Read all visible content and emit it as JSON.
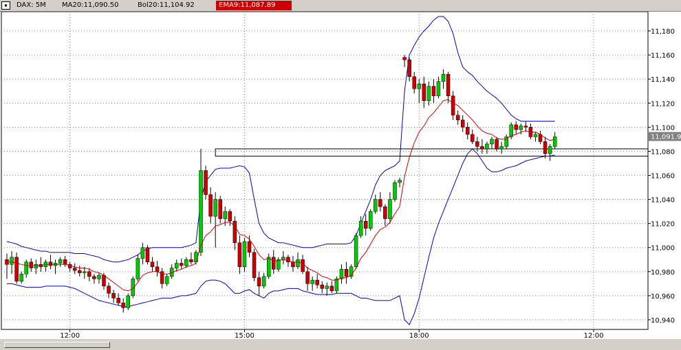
{
  "header": {
    "symbol_label": "DAX: 5M",
    "ma_label": "MA20:11,090.50",
    "bol_label": "Bol20:11,104.92",
    "ema_label": "EMA9:11,087.89",
    "ema_color": "#cc0000",
    "window_icon": "window-menu-icon"
  },
  "last_price_label": "11,091.9",
  "chart_data": {
    "type": "candlestick",
    "title": "",
    "ylim": [
      10932,
      11196
    ],
    "y_ticks": [
      {
        "value": 10940,
        "label": "10,940"
      },
      {
        "value": 10960,
        "label": "10,960"
      },
      {
        "value": 10980,
        "label": "10,980"
      },
      {
        "value": 11000,
        "label": "11,000"
      },
      {
        "value": 11020,
        "label": "11,020"
      },
      {
        "value": 11040,
        "label": "11,040"
      },
      {
        "value": 11060,
        "label": "11,060"
      },
      {
        "value": 11080,
        "label": "11,080"
      },
      {
        "value": 11100,
        "label": "11,100"
      },
      {
        "value": 11120,
        "label": "11,120"
      },
      {
        "value": 11140,
        "label": "11,140"
      },
      {
        "value": 11160,
        "label": "11,160"
      },
      {
        "value": 11180,
        "label": "11,180"
      }
    ],
    "x_ticks": [
      {
        "bar": 13,
        "label": "12:00"
      },
      {
        "bar": 49,
        "label": "15:00"
      },
      {
        "bar": 85,
        "label": "18:00"
      },
      {
        "bar": 121,
        "label": "12:00"
      }
    ],
    "vertical_grid_bars": [
      13,
      49,
      85,
      121
    ],
    "candles": [
      [
        10990,
        10995,
        10974,
        10986
      ],
      [
        10986,
        10997,
        10978,
        10992
      ],
      [
        10992,
        10996,
        10970,
        10972
      ],
      [
        10972,
        10980,
        10970,
        10978
      ],
      [
        10978,
        10990,
        10975,
        10988
      ],
      [
        10988,
        10991,
        10980,
        10983
      ],
      [
        10983,
        10990,
        10978,
        10986
      ],
      [
        10986,
        10992,
        10980,
        10984
      ],
      [
        10984,
        10990,
        10980,
        10988
      ],
      [
        10988,
        10994,
        10982,
        10985
      ],
      [
        10985,
        10990,
        10978,
        10987
      ],
      [
        10987,
        10992,
        10984,
        10990
      ],
      [
        10990,
        10993,
        10984,
        10986
      ],
      [
        10986,
        10988,
        10980,
        10983
      ],
      [
        10983,
        10987,
        10978,
        10981
      ],
      [
        10981,
        10985,
        10976,
        10979
      ],
      [
        10979,
        10984,
        10974,
        10980
      ],
      [
        10980,
        10983,
        10972,
        10976
      ],
      [
        10976,
        10978,
        10970,
        10974
      ],
      [
        10974,
        10979,
        10970,
        10977
      ],
      [
        10977,
        10979,
        10965,
        10968
      ],
      [
        10968,
        10971,
        10958,
        10962
      ],
      [
        10962,
        10965,
        10954,
        10958
      ],
      [
        10958,
        10962,
        10952,
        10954
      ],
      [
        10954,
        10958,
        10946,
        10950
      ],
      [
        10950,
        10962,
        10948,
        10960
      ],
      [
        10960,
        10976,
        10958,
        10974
      ],
      [
        10974,
        10994,
        10972,
        10991
      ],
      [
        10991,
        11004,
        10986,
        11000
      ],
      [
        11000,
        11002,
        10986,
        10988
      ],
      [
        10988,
        10992,
        10980,
        10984
      ],
      [
        10984,
        10989,
        10976,
        10980
      ],
      [
        10980,
        10983,
        10966,
        10970
      ],
      [
        10970,
        10978,
        10968,
        10976
      ],
      [
        10976,
        10986,
        10974,
        10983
      ],
      [
        10983,
        10990,
        10980,
        10987
      ],
      [
        10987,
        10991,
        10982,
        10985
      ],
      [
        10985,
        10992,
        10983,
        10990
      ],
      [
        10990,
        10996,
        10986,
        10988
      ],
      [
        10988,
        10998,
        10986,
        10996
      ],
      [
        10996,
        11082,
        10993,
        11064
      ],
      [
        11064,
        11068,
        11040,
        11044
      ],
      [
        11044,
        11050,
        11020,
        11026
      ],
      [
        11026,
        11046,
        11000,
        11040
      ],
      [
        11040,
        11043,
        11020,
        11024
      ],
      [
        11024,
        11034,
        11018,
        11030
      ],
      [
        11030,
        11032,
        11018,
        11022
      ],
      [
        11022,
        11026,
        10998,
        11004
      ],
      [
        11004,
        11010,
        10978,
        10984
      ],
      [
        10984,
        11008,
        10980,
        11005
      ],
      [
        11005,
        11010,
        10992,
        10996
      ],
      [
        10996,
        10999,
        10972,
        10975
      ],
      [
        10975,
        10980,
        10960,
        10968
      ],
      [
        10968,
        10979,
        10966,
        10976
      ],
      [
        10976,
        10995,
        10974,
        10992
      ],
      [
        10992,
        10998,
        10978,
        10982
      ],
      [
        10982,
        10992,
        10980,
        10990
      ],
      [
        10990,
        10997,
        10986,
        10992
      ],
      [
        10992,
        10994,
        10984,
        10988
      ],
      [
        10988,
        10993,
        10980,
        10984
      ],
      [
        10984,
        10996,
        10982,
        10990
      ],
      [
        10990,
        10994,
        10978,
        10980
      ],
      [
        10980,
        10984,
        10964,
        10970
      ],
      [
        10970,
        10976,
        10964,
        10973
      ],
      [
        10973,
        10978,
        10966,
        10969
      ],
      [
        10969,
        10972,
        10962,
        10966
      ],
      [
        10966,
        10971,
        10960,
        10968
      ],
      [
        10968,
        10972,
        10962,
        10964
      ],
      [
        10964,
        10976,
        10962,
        10974
      ],
      [
        10974,
        10986,
        10970,
        10982
      ],
      [
        10982,
        10988,
        10970,
        10976
      ],
      [
        10976,
        10986,
        10974,
        10984
      ],
      [
        10984,
        11012,
        10982,
        11010
      ],
      [
        11010,
        11026,
        11008,
        11022
      ],
      [
        11022,
        11028,
        11010,
        11016
      ],
      [
        11016,
        11032,
        11014,
        11030
      ],
      [
        11030,
        11044,
        11028,
        11040
      ],
      [
        11040,
        11046,
        11030,
        11034
      ],
      [
        11034,
        11036,
        11018,
        11024
      ],
      [
        11024,
        11046,
        11020,
        11040
      ],
      [
        11040,
        11056,
        11038,
        11054
      ],
      [
        11054,
        11058,
        11050,
        11056
      ],
      [
        11158,
        11160,
        11150,
        11156
      ],
      [
        11156,
        11158,
        11138,
        11142
      ],
      [
        11142,
        11146,
        11128,
        11132
      ],
      [
        11132,
        11140,
        11120,
        11136
      ],
      [
        11136,
        11142,
        11116,
        11122
      ],
      [
        11122,
        11138,
        11118,
        11134
      ],
      [
        11134,
        11140,
        11120,
        11126
      ],
      [
        11126,
        11142,
        11124,
        11138
      ],
      [
        11138,
        11148,
        11132,
        11144
      ],
      [
        11144,
        11146,
        11120,
        11126
      ],
      [
        11126,
        11130,
        11106,
        11110
      ],
      [
        11110,
        11114,
        11102,
        11106
      ],
      [
        11106,
        11110,
        11096,
        11100
      ],
      [
        11100,
        11104,
        11090,
        11094
      ],
      [
        11094,
        11098,
        11086,
        11088
      ],
      [
        11088,
        11092,
        11080,
        11084
      ],
      [
        11084,
        11090,
        11078,
        11082
      ],
      [
        11082,
        11088,
        11078,
        11086
      ],
      [
        11086,
        11092,
        11082,
        11090
      ],
      [
        11090,
        11092,
        11080,
        11082
      ],
      [
        11082,
        11088,
        11078,
        11084
      ],
      [
        11084,
        11094,
        11082,
        11092
      ],
      [
        11092,
        11104,
        11090,
        11102
      ],
      [
        11102,
        11105,
        11094,
        11098
      ],
      [
        11098,
        11103,
        11094,
        11101
      ],
      [
        11101,
        11105,
        11096,
        11100
      ],
      [
        11100,
        11103,
        11090,
        11092
      ],
      [
        11092,
        11096,
        11088,
        11094
      ],
      [
        11094,
        11097,
        11086,
        11088
      ],
      [
        11088,
        11092,
        11074,
        11078
      ],
      [
        11078,
        11086,
        11072,
        11084
      ],
      [
        11084,
        11096,
        11082,
        11092
      ]
    ],
    "bar_offset": 0,
    "bar_count_visible": 132,
    "ema9": [
      10988,
      10988,
      10987,
      10986,
      10985,
      10985,
      10985,
      10985,
      10986,
      10986,
      10986,
      10986,
      10986,
      10985,
      10984,
      10983,
      10983,
      10982,
      10980,
      10979,
      10977,
      10974,
      10971,
      10968,
      10965,
      10964,
      10966,
      10971,
      10977,
      10979,
      10980,
      10980,
      10978,
      10978,
      10979,
      10981,
      10982,
      10984,
      10985,
      10987,
      11002,
      11010,
      11013,
      11018,
      11019,
      11021,
      11021,
      11018,
      11011,
      11010,
      11007,
      11001,
      10994,
      10990,
      10991,
      10989,
      10989,
      10990,
      10989,
      10988,
      10988,
      10987,
      10983,
      10981,
      10979,
      10976,
      10975,
      10973,
      10973,
      10975,
      10975,
      10977,
      10983,
      10991,
      10996,
      11003,
      11010,
      11015,
      11017,
      11021,
      11028,
      11034,
      11059,
      11075,
      11087,
      11096,
      11101,
      11108,
      11112,
      11117,
      11122,
      11123,
      11120,
      11118,
      11114,
      11110,
      11106,
      11101,
      11097,
      11095,
      11094,
      11091,
      11090,
      11090,
      11093,
      11094,
      11096,
      11097,
      11096,
      11096,
      11094,
      11091,
      11089,
      11090
    ],
    "bollinger": {
      "upper": [
        11005,
        11004,
        11003,
        11001,
        11000,
        10999,
        10998,
        10997,
        10997,
        10996,
        10996,
        10996,
        10996,
        10996,
        10995,
        10995,
        10995,
        10994,
        10993,
        10992,
        10990,
        10989,
        10988,
        10988,
        10989,
        10990,
        10992,
        10994,
        10997,
        10999,
        11000,
        11000,
        11000,
        11000,
        11000,
        11000,
        11000,
        11001,
        11002,
        11004,
        11040,
        11055,
        11060,
        11065,
        11066,
        11066,
        11066,
        11067,
        11068,
        11067,
        11062,
        11040,
        11020,
        11012,
        11008,
        11006,
        11004,
        11004,
        11003,
        11002,
        11001,
        11000,
        11000,
        11000,
        11001,
        11002,
        11003,
        11003,
        11003,
        11003,
        11003,
        11004,
        11010,
        11020,
        11030,
        11040,
        11052,
        11060,
        11064,
        11066,
        11068,
        11072,
        11130,
        11160,
        11168,
        11175,
        11180,
        11184,
        11189,
        11192,
        11192,
        11188,
        11178,
        11162,
        11150,
        11146,
        11143,
        11138,
        11134,
        11130,
        11127,
        11124,
        11120,
        11115,
        11110,
        11107,
        11105,
        11105,
        11105,
        11105,
        11105,
        11105,
        11105,
        11105
      ],
      "lower": [
        10970,
        10970,
        10969,
        10968,
        10967,
        10967,
        10967,
        10967,
        10968,
        10968,
        10968,
        10968,
        10968,
        10967,
        10966,
        10964,
        10962,
        10960,
        10958,
        10956,
        10955,
        10954,
        10953,
        10952,
        10951,
        10951,
        10952,
        10953,
        10954,
        10955,
        10956,
        10957,
        10958,
        10958,
        10958,
        10959,
        10960,
        10960,
        10961,
        10962,
        10968,
        10972,
        10973,
        10973,
        10972,
        10970,
        10966,
        10962,
        10962,
        10964,
        10965,
        10962,
        10960,
        10958,
        10962,
        10964,
        10964,
        10965,
        10966,
        10966,
        10966,
        10964,
        10963,
        10962,
        10961,
        10961,
        10961,
        10961,
        10962,
        10962,
        10962,
        10962,
        10960,
        10958,
        10958,
        10957,
        10956,
        10956,
        10956,
        10956,
        10958,
        10960,
        10940,
        10936,
        10945,
        10958,
        10975,
        10992,
        11008,
        11020,
        11030,
        11040,
        11050,
        11060,
        11070,
        11078,
        11082,
        11078,
        11072,
        11066,
        11063,
        11063,
        11064,
        11066,
        11067,
        11068,
        11070,
        11072,
        11073,
        11074,
        11075,
        11076,
        11076,
        11077
      ]
    },
    "support_zone": {
      "top": 11082,
      "bottom": 11076
    },
    "colors": {
      "up": "#00cc00",
      "down": "#cc0000",
      "bollinger": "#0000cc",
      "ema": "#cc0000",
      "grid": "#808080",
      "wick": "#000000",
      "price_tag": "#808080"
    }
  }
}
